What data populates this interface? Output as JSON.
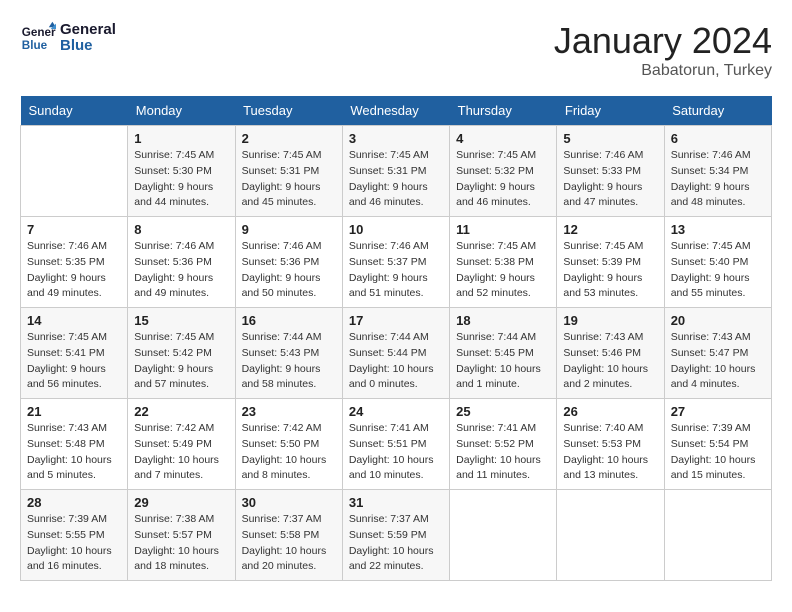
{
  "header": {
    "logo_line1": "General",
    "logo_line2": "Blue",
    "month": "January 2024",
    "location": "Babatorun, Turkey"
  },
  "days_of_week": [
    "Sunday",
    "Monday",
    "Tuesday",
    "Wednesday",
    "Thursday",
    "Friday",
    "Saturday"
  ],
  "weeks": [
    [
      {
        "day": "",
        "info": ""
      },
      {
        "day": "1",
        "info": "Sunrise: 7:45 AM\nSunset: 5:30 PM\nDaylight: 9 hours\nand 44 minutes."
      },
      {
        "day": "2",
        "info": "Sunrise: 7:45 AM\nSunset: 5:31 PM\nDaylight: 9 hours\nand 45 minutes."
      },
      {
        "day": "3",
        "info": "Sunrise: 7:45 AM\nSunset: 5:31 PM\nDaylight: 9 hours\nand 46 minutes."
      },
      {
        "day": "4",
        "info": "Sunrise: 7:45 AM\nSunset: 5:32 PM\nDaylight: 9 hours\nand 46 minutes."
      },
      {
        "day": "5",
        "info": "Sunrise: 7:46 AM\nSunset: 5:33 PM\nDaylight: 9 hours\nand 47 minutes."
      },
      {
        "day": "6",
        "info": "Sunrise: 7:46 AM\nSunset: 5:34 PM\nDaylight: 9 hours\nand 48 minutes."
      }
    ],
    [
      {
        "day": "7",
        "info": "Sunrise: 7:46 AM\nSunset: 5:35 PM\nDaylight: 9 hours\nand 49 minutes."
      },
      {
        "day": "8",
        "info": "Sunrise: 7:46 AM\nSunset: 5:36 PM\nDaylight: 9 hours\nand 49 minutes."
      },
      {
        "day": "9",
        "info": "Sunrise: 7:46 AM\nSunset: 5:36 PM\nDaylight: 9 hours\nand 50 minutes."
      },
      {
        "day": "10",
        "info": "Sunrise: 7:46 AM\nSunset: 5:37 PM\nDaylight: 9 hours\nand 51 minutes."
      },
      {
        "day": "11",
        "info": "Sunrise: 7:45 AM\nSunset: 5:38 PM\nDaylight: 9 hours\nand 52 minutes."
      },
      {
        "day": "12",
        "info": "Sunrise: 7:45 AM\nSunset: 5:39 PM\nDaylight: 9 hours\nand 53 minutes."
      },
      {
        "day": "13",
        "info": "Sunrise: 7:45 AM\nSunset: 5:40 PM\nDaylight: 9 hours\nand 55 minutes."
      }
    ],
    [
      {
        "day": "14",
        "info": "Sunrise: 7:45 AM\nSunset: 5:41 PM\nDaylight: 9 hours\nand 56 minutes."
      },
      {
        "day": "15",
        "info": "Sunrise: 7:45 AM\nSunset: 5:42 PM\nDaylight: 9 hours\nand 57 minutes."
      },
      {
        "day": "16",
        "info": "Sunrise: 7:44 AM\nSunset: 5:43 PM\nDaylight: 9 hours\nand 58 minutes."
      },
      {
        "day": "17",
        "info": "Sunrise: 7:44 AM\nSunset: 5:44 PM\nDaylight: 10 hours\nand 0 minutes."
      },
      {
        "day": "18",
        "info": "Sunrise: 7:44 AM\nSunset: 5:45 PM\nDaylight: 10 hours\nand 1 minute."
      },
      {
        "day": "19",
        "info": "Sunrise: 7:43 AM\nSunset: 5:46 PM\nDaylight: 10 hours\nand 2 minutes."
      },
      {
        "day": "20",
        "info": "Sunrise: 7:43 AM\nSunset: 5:47 PM\nDaylight: 10 hours\nand 4 minutes."
      }
    ],
    [
      {
        "day": "21",
        "info": "Sunrise: 7:43 AM\nSunset: 5:48 PM\nDaylight: 10 hours\nand 5 minutes."
      },
      {
        "day": "22",
        "info": "Sunrise: 7:42 AM\nSunset: 5:49 PM\nDaylight: 10 hours\nand 7 minutes."
      },
      {
        "day": "23",
        "info": "Sunrise: 7:42 AM\nSunset: 5:50 PM\nDaylight: 10 hours\nand 8 minutes."
      },
      {
        "day": "24",
        "info": "Sunrise: 7:41 AM\nSunset: 5:51 PM\nDaylight: 10 hours\nand 10 minutes."
      },
      {
        "day": "25",
        "info": "Sunrise: 7:41 AM\nSunset: 5:52 PM\nDaylight: 10 hours\nand 11 minutes."
      },
      {
        "day": "26",
        "info": "Sunrise: 7:40 AM\nSunset: 5:53 PM\nDaylight: 10 hours\nand 13 minutes."
      },
      {
        "day": "27",
        "info": "Sunrise: 7:39 AM\nSunset: 5:54 PM\nDaylight: 10 hours\nand 15 minutes."
      }
    ],
    [
      {
        "day": "28",
        "info": "Sunrise: 7:39 AM\nSunset: 5:55 PM\nDaylight: 10 hours\nand 16 minutes."
      },
      {
        "day": "29",
        "info": "Sunrise: 7:38 AM\nSunset: 5:57 PM\nDaylight: 10 hours\nand 18 minutes."
      },
      {
        "day": "30",
        "info": "Sunrise: 7:37 AM\nSunset: 5:58 PM\nDaylight: 10 hours\nand 20 minutes."
      },
      {
        "day": "31",
        "info": "Sunrise: 7:37 AM\nSunset: 5:59 PM\nDaylight: 10 hours\nand 22 minutes."
      },
      {
        "day": "",
        "info": ""
      },
      {
        "day": "",
        "info": ""
      },
      {
        "day": "",
        "info": ""
      }
    ]
  ]
}
